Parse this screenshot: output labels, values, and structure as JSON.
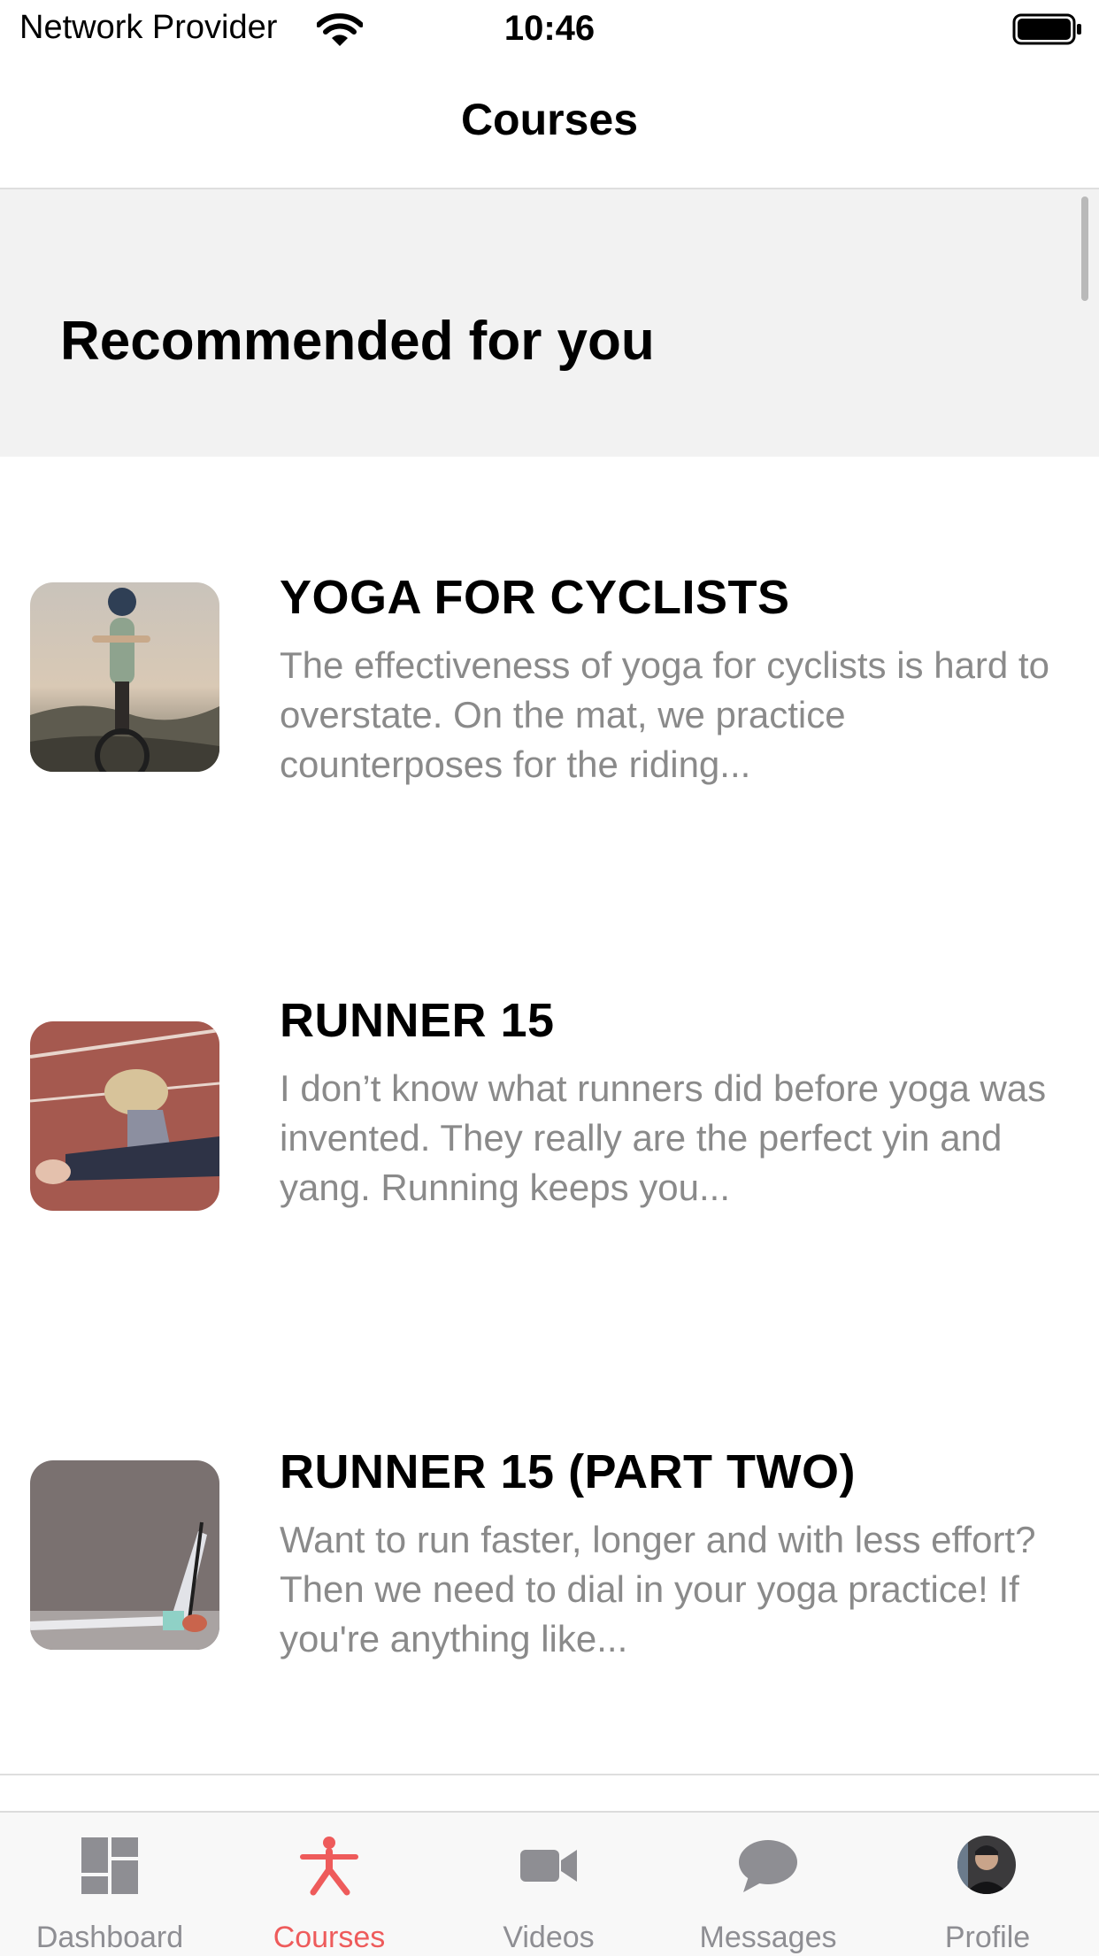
{
  "status_bar": {
    "carrier": "Network Provider",
    "time": "10:46",
    "wifi_icon": "wifi-icon",
    "battery_icon": "battery-full-icon"
  },
  "nav": {
    "title": "Courses"
  },
  "section": {
    "title": "Recommended for you"
  },
  "courses": [
    {
      "title": "YOGA FOR CYCLISTS",
      "description": "The effectiveness of yoga for cyclists is hard to overstate. On the mat, we practice counterposes for the riding...",
      "thumbnail": "cyclist-photo"
    },
    {
      "title": "RUNNER 15",
      "description": "I don’t know what runners did before yoga was invented. They really are the perfect yin and yang. Running keeps you...",
      "thumbnail": "runner-stretch-photo"
    },
    {
      "title": "RUNNER 15 (PART TWO)",
      "description": "Want to run faster, longer and with less effort? Then we need to dial in your yoga practice! If you're anything like...",
      "thumbnail": "yoga-strap-photo"
    }
  ],
  "tabs": [
    {
      "label": "Dashboard",
      "icon": "dashboard-icon",
      "active": false
    },
    {
      "label": "Courses",
      "icon": "yoga-figure-icon",
      "active": true
    },
    {
      "label": "Videos",
      "icon": "video-camera-icon",
      "active": false
    },
    {
      "label": "Messages",
      "icon": "chat-bubble-icon",
      "active": false
    },
    {
      "label": "Profile",
      "icon": "profile-avatar",
      "active": false
    }
  ],
  "colors": {
    "accent": "#ee5b5b",
    "tab_inactive": "#8e8e93",
    "section_bg": "#f2f2f2",
    "description_text": "#8a8a8a"
  }
}
